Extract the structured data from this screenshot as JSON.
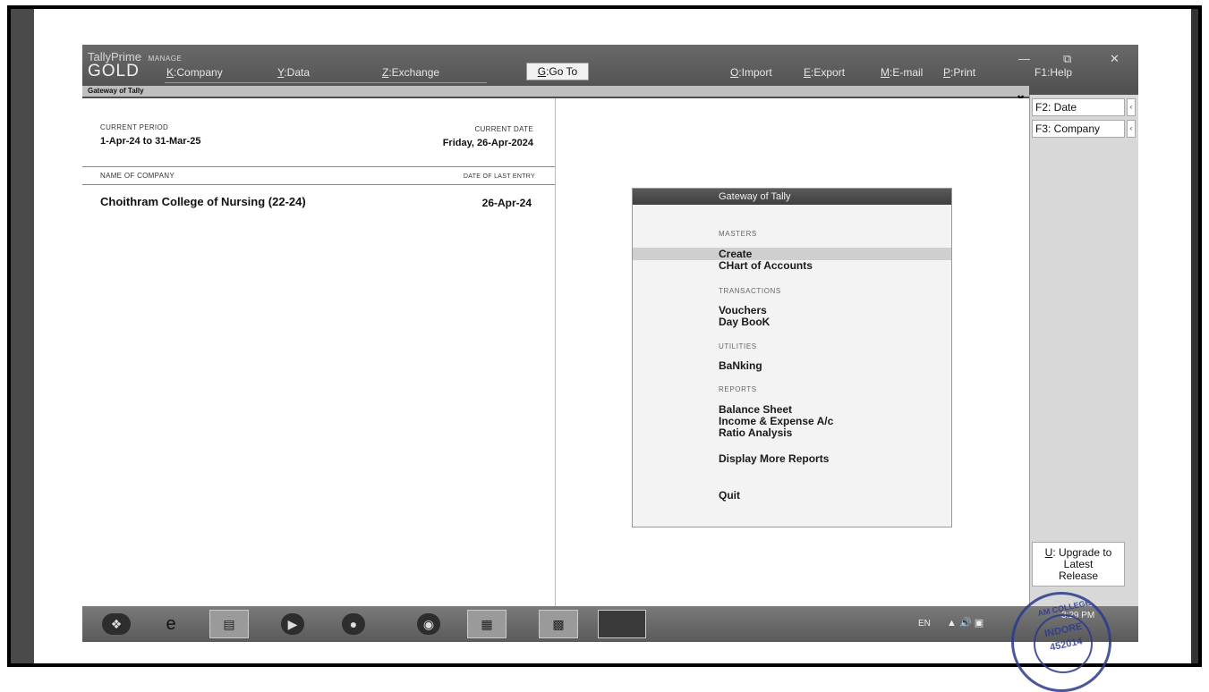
{
  "app": {
    "brand": "TallyPrime",
    "edition": "MANAGE",
    "tier": "GOLD",
    "breadcrumb": "Gateway of Tally"
  },
  "menu": {
    "company": {
      "key": "K",
      "label": ":Company"
    },
    "data": {
      "key": "Y",
      "label": ":Data"
    },
    "exchange": {
      "key": "Z",
      "label": ":Exchange"
    },
    "goto": {
      "key": "G",
      "label": ":Go To"
    },
    "import": {
      "key": "O",
      "label": ":Import"
    },
    "export": {
      "key": "E",
      "label": ":Export"
    },
    "email": {
      "key": "M",
      "label": ":E-mail"
    },
    "print": {
      "key": "P",
      "label": ":Print"
    },
    "help": {
      "key": "F1",
      "label": ":Help"
    }
  },
  "company_info": {
    "current_period_label": "CURRENT PERIOD",
    "current_period": "1-Apr-24 to 31-Mar-25",
    "current_date_label": "CURRENT DATE",
    "current_date": "Friday, 26-Apr-2024",
    "name_header": "NAME OF COMPANY",
    "last_entry_header": "DATE OF LAST ENTRY",
    "company_name": "Choithram College of Nursing (22-24)",
    "last_entry_date": "26-Apr-24"
  },
  "gateway": {
    "title": "Gateway of Tally",
    "masters_label": "MASTERS",
    "create": "Create",
    "chart_of_accounts": "CHart of Accounts",
    "transactions_label": "TRANSACTIONS",
    "vouchers": "Vouchers",
    "day_book": "Day BooK",
    "utilities_label": "UTILITIES",
    "banking": "BaNking",
    "reports_label": "REPORTS",
    "balance_sheet": "Balance Sheet",
    "income_expense": "Income & Expense A/c",
    "ratio_analysis": "Ratio Analysis",
    "more_reports": "Display More Reports",
    "quit": "Quit"
  },
  "sidebar": {
    "date_btn": "F2: Date",
    "company_btn": "F3: Company",
    "upgrade_key": "U",
    "upgrade_line1": ": Upgrade to",
    "upgrade_line2": "Latest",
    "upgrade_line3": "Release"
  },
  "taskbar": {
    "lang": "EN",
    "time": "3:29 PM"
  },
  "icons": {
    "start": "windows-orb-icon",
    "browser": "internet-explorer-icon",
    "explorer": "file-explorer-icon",
    "media": "media-player-icon",
    "app": "chrome-icon",
    "excel": "excel-icon",
    "tally": "tally-icon"
  },
  "colors": {
    "topbar": "#555555",
    "gateway_title": "#444444",
    "seal": "#2b3a8c"
  },
  "seal": {
    "line1": "AM COLLEGE",
    "line2": "INDORE",
    "line3": "452014"
  }
}
